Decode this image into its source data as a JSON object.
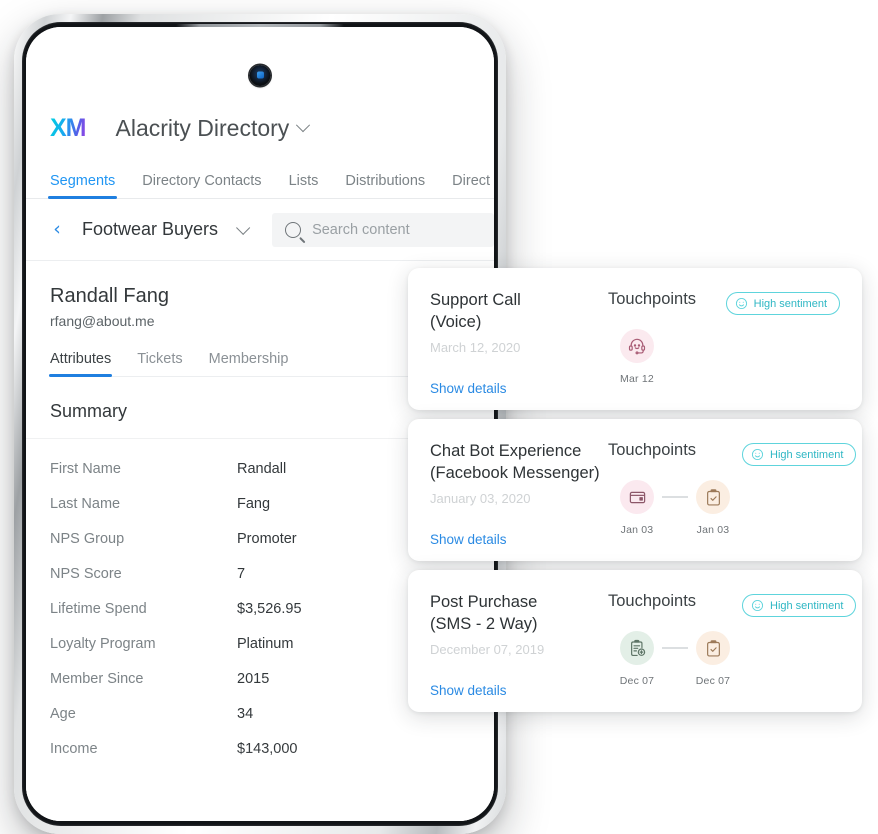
{
  "device": {
    "type": "smartphone",
    "camera": "front-camera"
  },
  "app": {
    "logo_text": "XM",
    "logo_gradient_from": "#00d1e0",
    "logo_gradient_to": "#9c3fe4",
    "directory_title": "Alacrity Directory",
    "accent_color": "#1f7fe0",
    "nav_tabs": [
      {
        "label": "Segments",
        "active": true
      },
      {
        "label": "Directory Contacts",
        "active": false
      },
      {
        "label": "Lists",
        "active": false
      },
      {
        "label": "Distributions",
        "active": false
      },
      {
        "label": "Direct",
        "active": false
      }
    ],
    "segment": {
      "back_label": "‹",
      "name": "Footwear Buyers"
    },
    "search": {
      "placeholder": "Search content",
      "value": ""
    },
    "contact": {
      "name": "Randall Fang",
      "email": "rfang@about.me",
      "tabs": [
        {
          "label": "Attributes",
          "active": true
        },
        {
          "label": "Tickets",
          "active": false
        },
        {
          "label": "Membership",
          "active": false
        }
      ],
      "section_title": "Summary",
      "attributes": [
        {
          "key": "First Name",
          "value": "Randall"
        },
        {
          "key": "Last Name",
          "value": "Fang"
        },
        {
          "key": "NPS Group",
          "value": "Promoter"
        },
        {
          "key": "NPS Score",
          "value": "7"
        },
        {
          "key": "Lifetime Spend",
          "value": "$3,526.95"
        },
        {
          "key": "Loyalty Program",
          "value": "Platinum"
        },
        {
          "key": "Member Since",
          "value": "2015"
        },
        {
          "key": "Age",
          "value": "34"
        },
        {
          "key": "Income",
          "value": "$143,000"
        }
      ]
    }
  },
  "cards": [
    {
      "title": "Support Call\n(Voice)",
      "title_line1": "Support Call",
      "title_line2": "(Voice)",
      "date": "March 12, 2020",
      "link": "Show details",
      "touchpoints_label": "Touchpoints",
      "sentiment": {
        "label": "High sentiment",
        "color": "#2fb7c4",
        "icon": "smiley-icon"
      },
      "touchpoints": [
        {
          "icon": "headset-icon",
          "date": "Mar 12",
          "bg": "#fbeaef",
          "fg": "#a85b74"
        }
      ]
    },
    {
      "title": "Chat Bot Experience\n(Facebook Messenger)",
      "title_line1": "Chat Bot Experience",
      "title_line2": "(Facebook Messenger)",
      "date": "January 03, 2020",
      "link": "Show details",
      "touchpoints_label": "Touchpoints",
      "sentiment": {
        "label": "High sentiment",
        "color": "#2fb7c4",
        "icon": "smiley-icon"
      },
      "touchpoints": [
        {
          "icon": "chat-window-icon",
          "date": "Jan 03",
          "bg": "#fbe9ef",
          "fg": "#8c5668"
        },
        {
          "icon": "clipboard-check-icon",
          "date": "Jan 03",
          "bg": "#fbeee2",
          "fg": "#9c7a59"
        }
      ]
    },
    {
      "title": "Post Purchase\n(SMS - 2 Way)",
      "title_line1": "Post Purchase",
      "title_line2": "(SMS - 2 Way)",
      "date": "December 07, 2019",
      "link": "Show details",
      "touchpoints_label": "Touchpoints",
      "sentiment": {
        "label": "High sentiment",
        "color": "#2fb7c4",
        "icon": "smiley-icon"
      },
      "touchpoints": [
        {
          "icon": "clipboard-add-icon",
          "date": "Dec 07",
          "bg": "#e3efe7",
          "fg": "#5d7466"
        },
        {
          "icon": "clipboard-check-icon",
          "date": "Dec 07",
          "bg": "#fbeee2",
          "fg": "#9c7a59"
        }
      ]
    }
  ]
}
